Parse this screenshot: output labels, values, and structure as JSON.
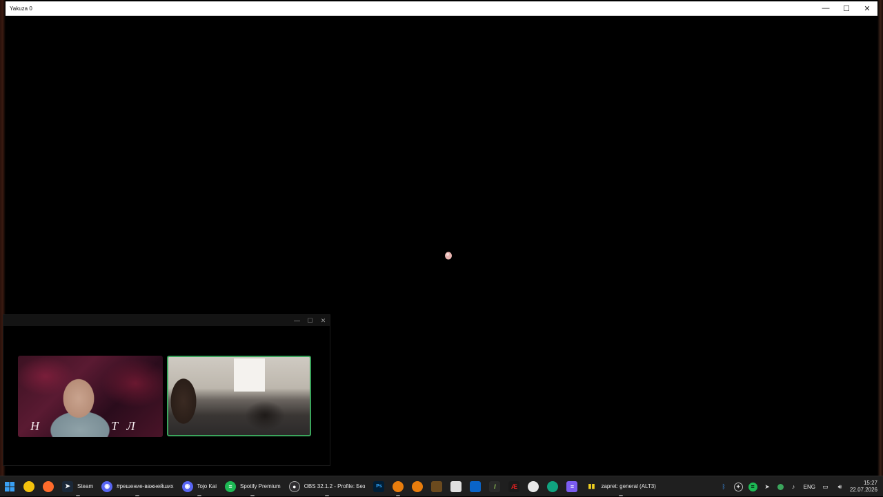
{
  "game_window": {
    "title": "Yakuza 0",
    "controls": {
      "minimize": "—",
      "maximize": "☐",
      "close": "✕"
    }
  },
  "call_window": {
    "controls": {
      "minimize": "—",
      "maximize": "☐",
      "close": "✕"
    },
    "tile_1": {
      "overlay_text_left": "Н",
      "overlay_text_right": "Т Л"
    },
    "speaking_color": "#3ba55c"
  },
  "taskbar": {
    "items": [
      {
        "label": "",
        "icon": "windows-start-icon"
      },
      {
        "label": "",
        "icon": "chrome-icon"
      },
      {
        "label": "",
        "icon": "firefox-icon"
      },
      {
        "label": "Steam",
        "icon": "steam-icon"
      },
      {
        "label": "#решение-важнейших",
        "icon": "discord-icon"
      },
      {
        "label": "Tojo Kai",
        "icon": "discord-icon"
      },
      {
        "label": "Spotify Premium",
        "icon": "spotify-icon"
      },
      {
        "label": "OBS 32.1.2 - Profile: Без",
        "icon": "obs-icon"
      },
      {
        "label": "",
        "icon": "photoshop-icon"
      },
      {
        "label": "",
        "icon": "blender-icon"
      },
      {
        "label": "",
        "icon": "blender-icon"
      },
      {
        "label": "",
        "icon": "app-icon"
      },
      {
        "label": "",
        "icon": "app-icon"
      },
      {
        "label": "",
        "icon": "app-icon"
      },
      {
        "label": "",
        "icon": "app-icon"
      },
      {
        "label": "",
        "icon": "app-icon"
      },
      {
        "label": "",
        "icon": "app-icon"
      },
      {
        "label": "",
        "icon": "app-icon"
      },
      {
        "label": "",
        "icon": "app-icon"
      },
      {
        "label": "zapret: general (ALT3)",
        "icon": "zapret-icon"
      }
    ],
    "tray": {
      "language": "ENG",
      "time": "15:27",
      "date": "22.07.2026"
    }
  },
  "colors": {
    "taskbar_bg": "#1f1f1f",
    "accent_speaking": "#3ba55c"
  }
}
